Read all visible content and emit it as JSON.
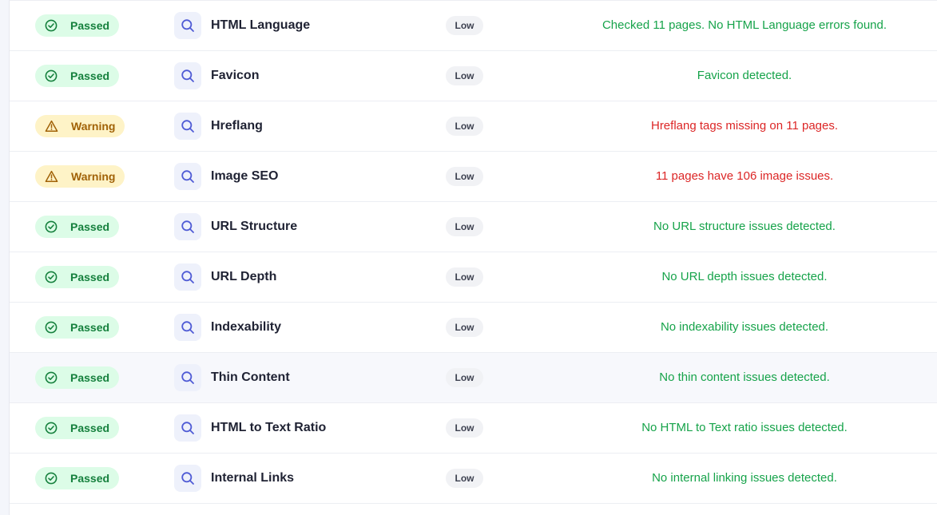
{
  "colors": {
    "passed_bg": "#dcfce7",
    "passed_text": "#15803d",
    "warning_bg": "#fef3c7",
    "warning_text": "#a16207",
    "message_ok": "#16a34a",
    "message_bad": "#dc2626"
  },
  "rows": [
    {
      "status": "Passed",
      "type": "passed",
      "icon": "search-icon",
      "name": "HTML Language",
      "priority": "Low",
      "message": "Checked 11 pages. No HTML Language errors found.",
      "message_type": "ok"
    },
    {
      "status": "Passed",
      "type": "passed",
      "icon": "search-icon",
      "name": "Favicon",
      "priority": "Low",
      "message": "Favicon detected.",
      "message_type": "ok"
    },
    {
      "status": "Warning",
      "type": "warning",
      "icon": "search-icon",
      "name": "Hreflang",
      "priority": "Low",
      "message": "Hreflang tags missing on 11 pages.",
      "message_type": "bad"
    },
    {
      "status": "Warning",
      "type": "warning",
      "icon": "search-icon",
      "name": "Image SEO",
      "priority": "Low",
      "message": "11 pages have 106 image issues.",
      "message_type": "bad"
    },
    {
      "status": "Passed",
      "type": "passed",
      "icon": "search-icon",
      "name": "URL Structure",
      "priority": "Low",
      "message": "No URL structure issues detected.",
      "message_type": "ok"
    },
    {
      "status": "Passed",
      "type": "passed",
      "icon": "search-icon",
      "name": "URL Depth",
      "priority": "Low",
      "message": "No URL depth issues detected.",
      "message_type": "ok"
    },
    {
      "status": "Passed",
      "type": "passed",
      "icon": "search-icon",
      "name": "Indexability",
      "priority": "Low",
      "message": "No indexability issues detected.",
      "message_type": "ok"
    },
    {
      "status": "Passed",
      "type": "passed",
      "icon": "search-icon",
      "name": "Thin Content",
      "priority": "Low",
      "message": "No thin content issues detected.",
      "message_type": "ok",
      "hover": true
    },
    {
      "status": "Passed",
      "type": "passed",
      "icon": "search-icon",
      "name": "HTML to Text Ratio",
      "priority": "Low",
      "message": "No HTML to Text ratio issues detected.",
      "message_type": "ok"
    },
    {
      "status": "Passed",
      "type": "passed",
      "icon": "search-icon",
      "name": "Internal Links",
      "priority": "Low",
      "message": "No internal linking issues detected.",
      "message_type": "ok"
    }
  ]
}
